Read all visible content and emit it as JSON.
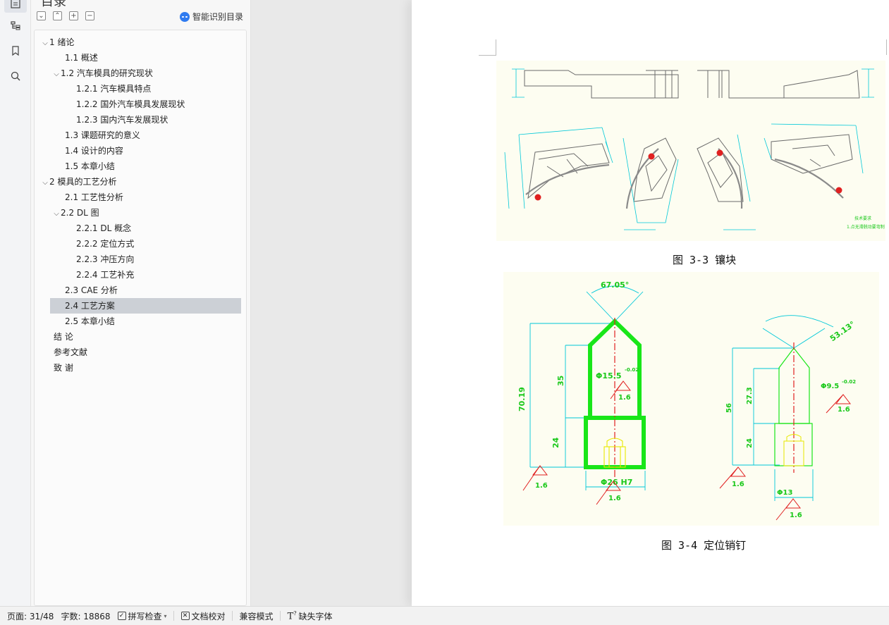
{
  "toc": {
    "title": "目录",
    "smart_label": "智能识别目录",
    "items": [
      {
        "label": "1  绪论",
        "level": 0,
        "chev": "v"
      },
      {
        "label": "1.1  概述",
        "level": 1,
        "chev": ""
      },
      {
        "label": "1.2  汽车模具的研究现状",
        "level": 1,
        "chev": "v"
      },
      {
        "label": "1.2.1  汽车模具特点",
        "level": 2,
        "chev": ""
      },
      {
        "label": "1.2.2  国外汽车模具发展现状",
        "level": 2,
        "chev": ""
      },
      {
        "label": "1.2.3  国内汽车发展现状",
        "level": 2,
        "chev": ""
      },
      {
        "label": "1.3  课题研究的意义",
        "level": 1,
        "chev": ""
      },
      {
        "label": "1.4  设计的内容",
        "level": 1,
        "chev": ""
      },
      {
        "label": "1.5  本章小结",
        "level": 1,
        "chev": ""
      },
      {
        "label": "2  模具的工艺分析",
        "level": 0,
        "chev": "v"
      },
      {
        "label": "2.1  工艺性分析",
        "level": 1,
        "chev": ""
      },
      {
        "label": "2.2 DL 图",
        "level": 1,
        "chev": "v"
      },
      {
        "label": "2.2.1 DL 概念",
        "level": 2,
        "chev": ""
      },
      {
        "label": "2.2.2  定位方式",
        "level": 2,
        "chev": ""
      },
      {
        "label": "2.2.3  冲压方向",
        "level": 2,
        "chev": ""
      },
      {
        "label": "2.2.4  工艺补充",
        "level": 2,
        "chev": ""
      },
      {
        "label": "2.3 CAE 分析",
        "level": 1,
        "chev": ""
      },
      {
        "label": "2.4  工艺方案",
        "level": 1,
        "chev": "",
        "selected": true
      },
      {
        "label": "2.5  本章小结",
        "level": 1,
        "chev": ""
      },
      {
        "label": "结   论",
        "level": 0,
        "chev": ""
      },
      {
        "label": "参考文献",
        "level": 0,
        "chev": ""
      },
      {
        "label": "致   谢",
        "level": 0,
        "chev": ""
      }
    ]
  },
  "document": {
    "fig1_caption": "图 3-3 镶块",
    "fig2_caption": "图 3-4 定位销钉",
    "fig1_notes": {
      "tech_req_1": "技术要求",
      "tech_req_2": "1.点无滑脱动要弯制"
    },
    "fig2_labels": {
      "angle_left": "67.05°",
      "angle_right": "53.13°",
      "total_height_left": "70.19",
      "upper_height_left": "35",
      "lower_height_left": "24",
      "upper_dia_left": "Φ15.5",
      "upper_tol_left": "-0.02",
      "base_dia_left": "Φ26 H7",
      "total_height_right": "56",
      "upper_height_right": "27.3",
      "lower_height_right": "24",
      "upper_dia_right": "Φ9.5",
      "upper_tol_right": "-0.02",
      "base_dia_right": "Φ13",
      "roughness": "1.6"
    }
  },
  "status_bar": {
    "page": "页面: 31/48",
    "words": "字数: 18868",
    "spell": "拼写检查",
    "proof": "文档校对",
    "compat": "兼容模式",
    "fonts": "缺失字体"
  },
  "colors": {
    "selected_row": "#ccd0d6",
    "drawing_bg": "#fdfdf1",
    "cyan_dim": "#00c8d8",
    "green_part": "#19e619",
    "red_center": "#e02020"
  }
}
